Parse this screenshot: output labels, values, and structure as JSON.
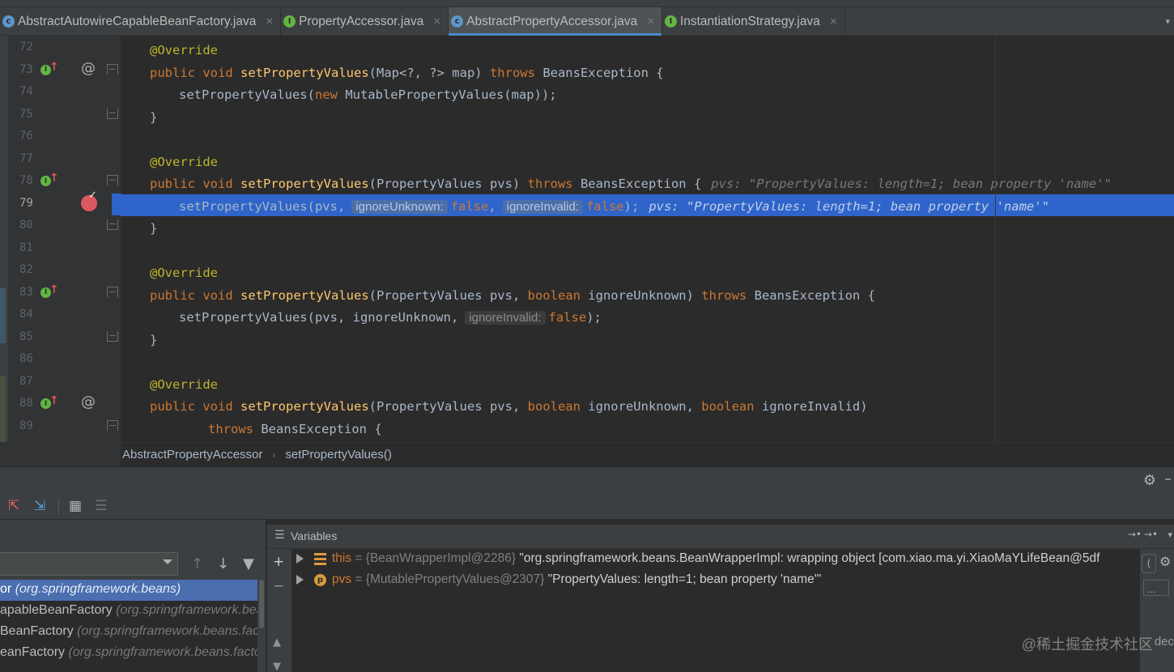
{
  "tabs": [
    {
      "label": "AbstractAutowireCapableBeanFactory.java",
      "icon": "class-icon",
      "active": false
    },
    {
      "label": "PropertyAccessor.java",
      "icon": "interface-icon",
      "active": false
    },
    {
      "label": "AbstractPropertyAccessor.java",
      "icon": "class-icon",
      "active": true
    },
    {
      "label": "InstantiationStrategy.java",
      "icon": "interface-icon",
      "active": false
    }
  ],
  "editor": {
    "current_line": 79,
    "lines": [
      {
        "n": "72",
        "code": "@Override"
      },
      {
        "n": "73",
        "code": "public void setPropertyValues(Map<?, ?> map) throws BeansException {"
      },
      {
        "n": "74",
        "code": "setPropertyValues(new MutablePropertyValues(map));"
      },
      {
        "n": "75",
        "code": "}"
      },
      {
        "n": "76",
        "code": ""
      },
      {
        "n": "77",
        "code": "@Override"
      },
      {
        "n": "78",
        "code": "public void setPropertyValues(PropertyValues pvs) throws BeansException {",
        "inline_value": "pvs: \"PropertyValues: length=1; bean property 'name'\""
      },
      {
        "n": "79",
        "code": "setPropertyValues(pvs, ignoreUnknown: false, ignoreInvalid: false);",
        "inline_value": "pvs: \"PropertyValues: length=1; bean property 'name'\""
      },
      {
        "n": "80",
        "code": "}"
      },
      {
        "n": "81",
        "code": ""
      },
      {
        "n": "82",
        "code": "@Override"
      },
      {
        "n": "83",
        "code": "public void setPropertyValues(PropertyValues pvs, boolean ignoreUnknown) throws BeansException {"
      },
      {
        "n": "84",
        "code": "setPropertyValues(pvs, ignoreUnknown, ignoreInvalid: false);"
      },
      {
        "n": "85",
        "code": "}"
      },
      {
        "n": "86",
        "code": ""
      },
      {
        "n": "87",
        "code": "@Override"
      },
      {
        "n": "88",
        "code": "public void setPropertyValues(PropertyValues pvs, boolean ignoreUnknown, boolean ignoreInvalid)"
      },
      {
        "n": "89",
        "code": "throws BeansException {"
      }
    ],
    "tokens": {
      "override": "@Override",
      "public": "public",
      "void": "void",
      "method": "setPropertyValues",
      "throws": "throws",
      "beans_exception": "BeansException {",
      "new_kw": "new",
      "boolean_kw": "boolean",
      "false_kw": "false",
      "hint_ignore_unknown": "ignoreUnknown:",
      "hint_ignore_invalid": "ignoreInvalid:",
      "l73_params": "(Map<?, ?> map) ",
      "l74_pre": "setPropertyValues(",
      "l74_post": " MutablePropertyValues(map));",
      "l78_params": "(PropertyValues pvs) ",
      "l79_pre": "setPropertyValues(pvs,",
      "l79_comma": ",",
      "l79_end": ");",
      "l83_a": "(PropertyValues pvs, ",
      "l83_b": " ignoreUnknown) ",
      "l84_pre": "setPropertyValues(pvs, ignoreUnknown,",
      "l84_end": ");",
      "l88_a": "(PropertyValues pvs, ",
      "l88_b": " ignoreUnknown, ",
      "l88_c": " ignoreInvalid)",
      "brace_close": "}"
    },
    "gutter_at_symbol": "@"
  },
  "breadcrumbs": [
    "AbstractPropertyAccessor",
    "setPropertyValues()"
  ],
  "frames": {
    "rows": [
      {
        "method": "or",
        "package": "(org.springframework.beans)",
        "selected": true
      },
      {
        "method": "apableBeanFactory",
        "package": "(org.springframework.bea",
        "selected": false
      },
      {
        "method": "BeanFactory",
        "package": "(org.springframework.beans.fact",
        "selected": false
      },
      {
        "method": "eanFactory",
        "package": "(org.springframework.beans.facto",
        "selected": false
      }
    ]
  },
  "variables": {
    "title": "Variables",
    "items": [
      {
        "name": "this",
        "eq": " = ",
        "type": "{BeanWrapperImpl@2286}",
        "value": " \"org.springframework.beans.BeanWrapperImpl: wrapping object [com.xiao.ma.yi.XiaoMaYLifeBean@5df",
        "icon": "field-icon"
      },
      {
        "name": "pvs",
        "eq": " = ",
        "type": "{MutablePropertyValues@2307}",
        "value": " \"PropertyValues: length=1; bean property 'name'\"",
        "icon": "parameter-icon"
      }
    ]
  },
  "watermark": "@稀土掘金技术社区",
  "watermark_tail": "dec",
  "colors": {
    "current_line": "#2f65ca",
    "keyword": "#cc7832",
    "method": "#ffc66d",
    "annotation": "#bbb529",
    "selected_frame": "#4b6eaf"
  }
}
